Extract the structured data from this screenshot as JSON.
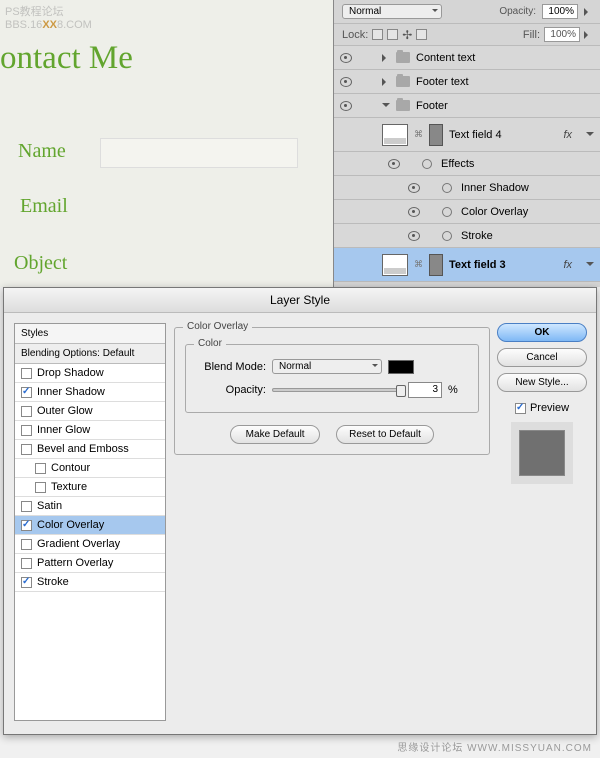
{
  "watermark": {
    "line1": "PS教程论坛",
    "line2a": "BBS.16",
    "line2b": "XX",
    "line2c": "8.COM"
  },
  "doc": {
    "title": "ontact Me",
    "labels": {
      "name": "Name",
      "email": "Email",
      "object": "Object"
    }
  },
  "layers": {
    "blendMode": "Normal",
    "opacityLabel": "Opacity:",
    "opacity": "100%",
    "lockLabel": "Lock:",
    "fillLabel": "Fill:",
    "fill": "100%",
    "groups": [
      {
        "name": "Content text"
      },
      {
        "name": "Footer text"
      },
      {
        "name": "Footer"
      }
    ],
    "textField4": "Text field 4",
    "textField3": "Text field 3",
    "effects": "Effects",
    "fx": [
      "Inner Shadow",
      "Color Overlay",
      "Stroke"
    ],
    "fxBadge": "fx"
  },
  "dialog": {
    "title": "Layer Style",
    "stylesHeader": "Styles",
    "blendingDefault": "Blending Options: Default",
    "items": [
      {
        "label": "Drop Shadow",
        "checked": false
      },
      {
        "label": "Inner Shadow",
        "checked": true
      },
      {
        "label": "Outer Glow",
        "checked": false
      },
      {
        "label": "Inner Glow",
        "checked": false
      },
      {
        "label": "Bevel and Emboss",
        "checked": false
      },
      {
        "label": "Contour",
        "checked": false,
        "indent": true
      },
      {
        "label": "Texture",
        "checked": false,
        "indent": true
      },
      {
        "label": "Satin",
        "checked": false
      },
      {
        "label": "Color Overlay",
        "checked": true,
        "selected": true
      },
      {
        "label": "Gradient Overlay",
        "checked": false
      },
      {
        "label": "Pattern Overlay",
        "checked": false
      },
      {
        "label": "Stroke",
        "checked": true
      }
    ],
    "overlay": {
      "groupTitle": "Color Overlay",
      "colorTitle": "Color",
      "blendLabel": "Blend Mode:",
      "blendValue": "Normal",
      "opacityLabel": "Opacity:",
      "opacityValue": "3",
      "pct": "%",
      "makeDefault": "Make Default",
      "resetDefault": "Reset to Default",
      "swatchColor": "#000000"
    },
    "buttons": {
      "ok": "OK",
      "cancel": "Cancel",
      "newStyle": "New Style...",
      "preview": "Preview"
    }
  },
  "footerWm": "思缘设计论坛  WWW.MISSYUAN.COM"
}
